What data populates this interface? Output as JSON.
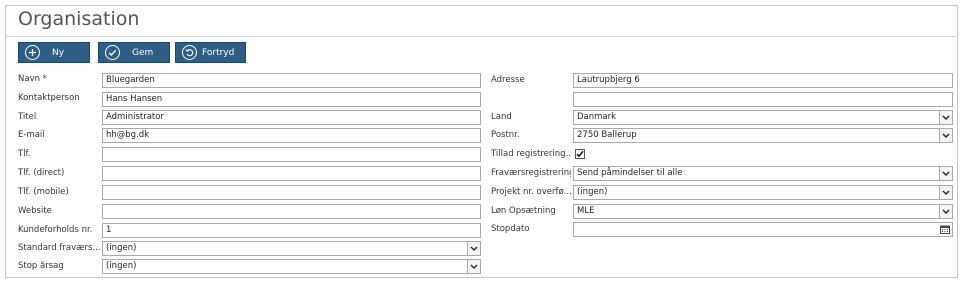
{
  "header": {
    "title": "Organisation"
  },
  "toolbar": {
    "new_label": "Ny",
    "save_label": "Gem",
    "undo_label": "Fortryd"
  },
  "left": {
    "name_label": "Navn *",
    "name_value": "Bluegarden",
    "contact_label": "Kontaktperson",
    "contact_value": "Hans Hansen",
    "title_label": "Titel",
    "title_value": "Administrator",
    "email_label": "E-mail",
    "email_value": "hh@bg.dk",
    "phone_label": "Tlf.",
    "phone_value": "",
    "phone_direct_label": "Tlf. (direct)",
    "phone_direct_value": "",
    "phone_mobile_label": "Tlf. (mobile)",
    "phone_mobile_value": "",
    "website_label": "Website",
    "website_value": "",
    "customer_no_label": "Kundeforholds nr.",
    "customer_no_value": "1",
    "std_absence_label": "Standard fraværs...",
    "std_absence_value": "(ingen)",
    "stop_reason_label": "Stop årsag",
    "stop_reason_value": "(ingen)"
  },
  "right": {
    "address_label": "Adresse",
    "address_line1": "Lautrupbjerg 6",
    "address_line2": "",
    "country_label": "Land",
    "country_value": "Danmark",
    "postal_label": "Postnr.",
    "postal_value": "2750 Ballerup",
    "allow_reg_label": "Tillad registrering...",
    "allow_reg_checked": true,
    "absence_reg_label": "Fraværsregistrering",
    "absence_reg_value": "Send påmindelser til alle",
    "project_transfer_label": "Projekt nr. overfø...",
    "project_transfer_value": "(ingen)",
    "payroll_label": "Løn Opsætning",
    "payroll_value": "MLE",
    "stop_date_label": "Stopdato",
    "stop_date_value": ""
  },
  "icons": {
    "new": "plus-circle-icon",
    "save": "check-circle-icon",
    "undo": "undo-circle-icon",
    "dropdown": "chevron-down-icon",
    "calendar": "calendar-icon",
    "checkbox": "checkmark-icon"
  },
  "colors": {
    "button_bg": "#2e5e85",
    "border": "#a9a9a9",
    "text": "#333333"
  }
}
